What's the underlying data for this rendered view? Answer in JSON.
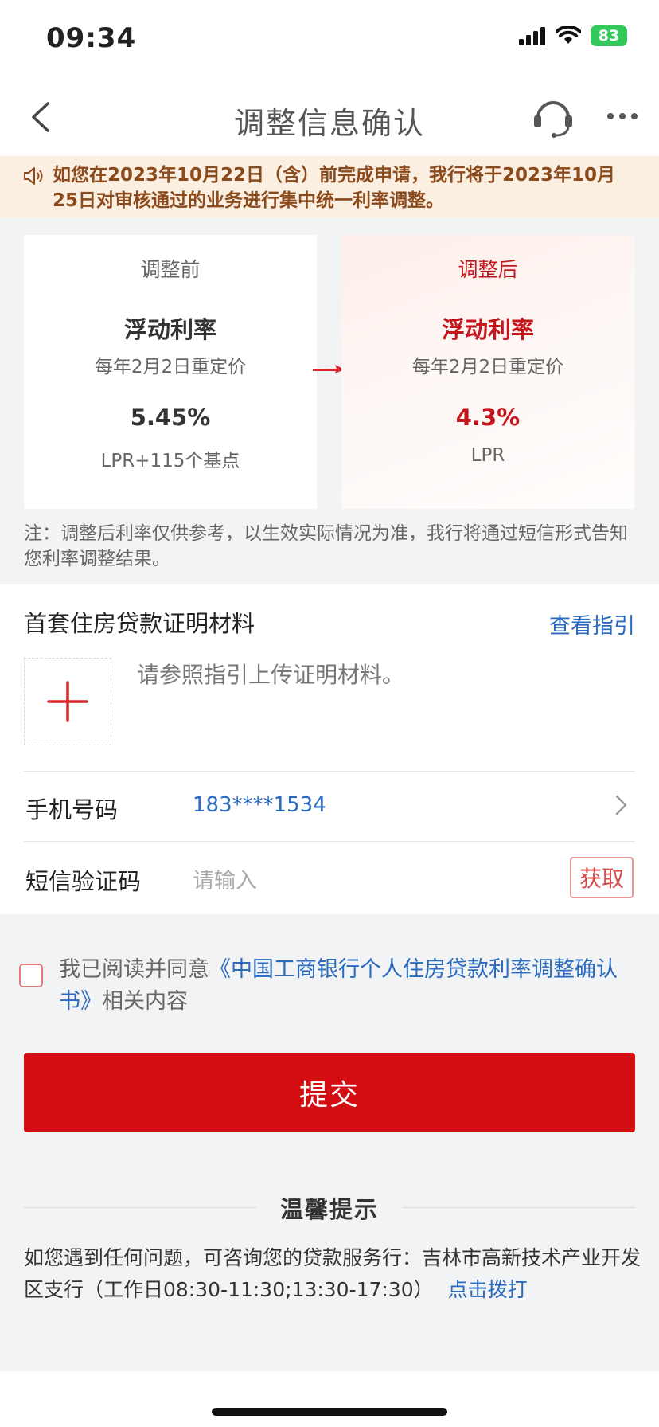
{
  "status_bar": {
    "time": "09:34",
    "battery": "83"
  },
  "nav": {
    "title": "调整信息确认"
  },
  "notice": {
    "text": "如您在2023年10月22日（含）前完成申请，我行将于2023年10月25日对审核通过的业务进行集中统一利率调整。"
  },
  "comparison": {
    "before": {
      "label": "调整前",
      "mode": "浮动利率",
      "reprice": "每年2月2日重定价",
      "rate": "5.45%",
      "basis": "LPR+115个基点"
    },
    "after": {
      "label": "调整后",
      "mode": "浮动利率",
      "reprice": "每年2月2日重定价",
      "rate": "4.3%",
      "basis": "LPR"
    },
    "note": "注：调整后利率仅供参考，以生效实际情况为准，我行将通过短信形式告知您利率调整结果。"
  },
  "documents": {
    "title": "首套住房贷款证明材料",
    "guide_link": "查看指引",
    "upload_hint": "请参照指引上传证明材料。"
  },
  "phone": {
    "label": "手机号码",
    "value": "183****1534"
  },
  "sms": {
    "label": "短信验证码",
    "placeholder": "请输入",
    "button": "获取"
  },
  "agreement": {
    "prefix": "我已阅读并同意",
    "link": "《中国工商银行个人住房贷款利率调整确认书》",
    "suffix": "相关内容"
  },
  "submit": {
    "label": "提交"
  },
  "tips": {
    "title": "温馨提示",
    "text": "如您遇到任何问题，可咨询您的贷款服务行：吉林市高新技术产业开发区支行（工作日08:30-11:30;13:30-17:30）",
    "call_link": "点击拨打"
  },
  "colors": {
    "brand_red": "#d40d12",
    "link_blue": "#2a6bbf",
    "notice_bg": "#fbefe2"
  },
  "icons": [
    "back-icon",
    "headset-icon",
    "more-icon",
    "speaker-icon",
    "arrow-right-icon",
    "plus-icon",
    "chevron-right-icon"
  ]
}
